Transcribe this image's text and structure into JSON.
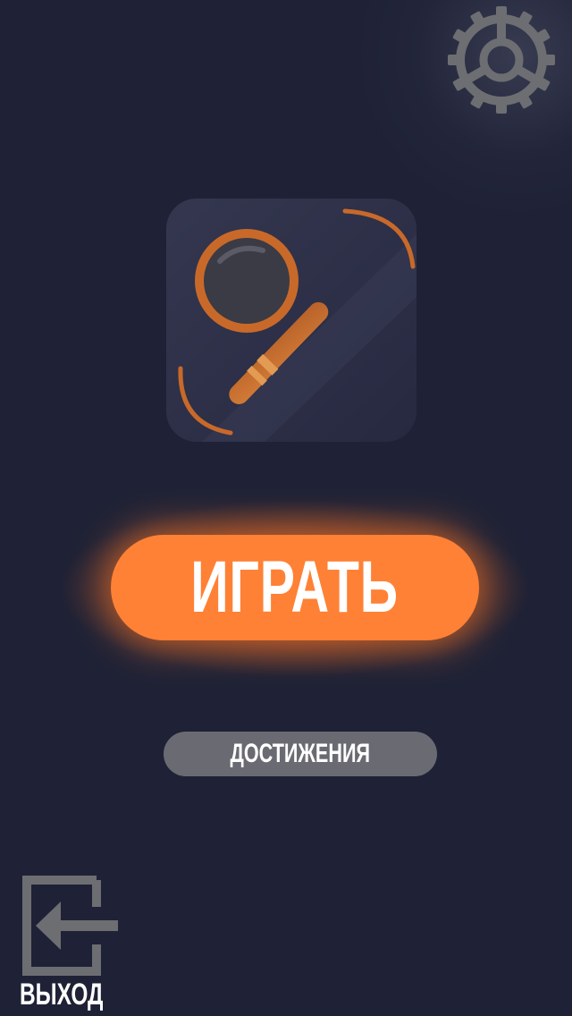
{
  "menu": {
    "play_label": "ИГРАТЬ",
    "achievements_label": "ДОСТИЖЕНИЯ",
    "exit_label": "ВЫХОД"
  },
  "icons": {
    "settings": "gear-icon",
    "logo": "magnifying-glass-icon",
    "exit": "exit-door-arrow-icon"
  },
  "colors": {
    "background": "#1f2236",
    "accent": "#ff8135",
    "secondary_button": "#6a6b72",
    "icon_gray": "#6d6e72",
    "logo_tile": "#2d3048",
    "logo_copper": "#c8692a"
  }
}
